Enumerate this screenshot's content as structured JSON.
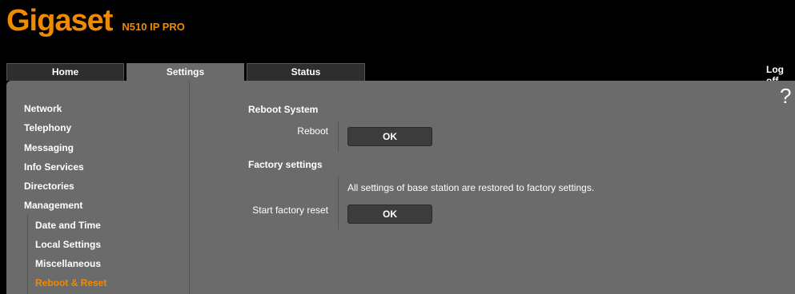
{
  "header": {
    "logo_text": "Gigaset",
    "model": "N510 IP PRO",
    "logoff": "Log off"
  },
  "tabs": [
    {
      "label": "Home"
    },
    {
      "label": "Settings",
      "active": true
    },
    {
      "label": "Status"
    }
  ],
  "sidebar": {
    "items": [
      {
        "label": "Network"
      },
      {
        "label": "Telephony"
      },
      {
        "label": "Messaging"
      },
      {
        "label": "Info Services"
      },
      {
        "label": "Directories"
      },
      {
        "label": "Management"
      }
    ],
    "subitems": [
      {
        "label": "Date and Time"
      },
      {
        "label": "Local Settings"
      },
      {
        "label": "Miscellaneous"
      },
      {
        "label": "Reboot & Reset",
        "active": true
      }
    ]
  },
  "help_symbol": "?",
  "content": {
    "reboot_title": "Reboot System",
    "reboot_label": "Reboot",
    "reboot_button": "OK",
    "factory_title": "Factory settings",
    "factory_info": "All settings of base station are restored to factory settings.",
    "factory_label": "Start factory reset",
    "factory_button": "OK"
  },
  "colors": {
    "accent": "#f08a00",
    "panel": "#6b6b6b",
    "background": "#000000"
  }
}
